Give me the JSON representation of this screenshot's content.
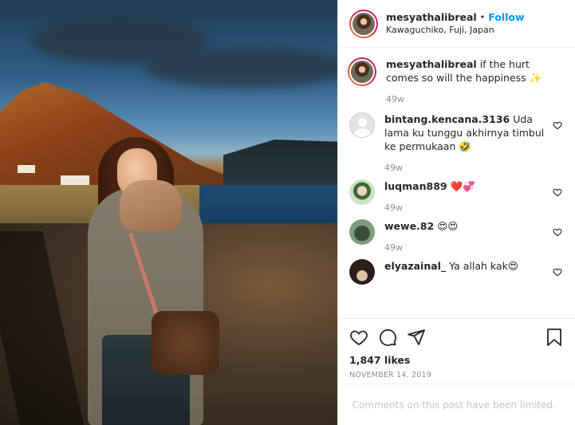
{
  "post": {
    "username": "mesyathalibreal",
    "follow_label": "Follow",
    "location": "Kawaguchiko, Fuji, Japan"
  },
  "comments": [
    {
      "username": "mesyathalibreal",
      "text": "if the hurt comes so will the happiness ✨",
      "age": "49w"
    },
    {
      "username": "bintang.kencana.3136",
      "text": "Uda lama ku tunggu akhirnya timbul ke permukaan 🤣",
      "age": "49w"
    },
    {
      "username": "luqman889",
      "text": "❤️💞",
      "age": "49w"
    },
    {
      "username": "wewe.82",
      "text": "😍😍",
      "age": "49w"
    },
    {
      "username": "elyazainal_",
      "text": "Ya allah kak😍",
      "age": ""
    }
  ],
  "actions": {
    "likes": "1,847 likes",
    "date": "NOVEMBER 14, 2019"
  },
  "footer": {
    "limited_text": "Comments on this post have been limited."
  },
  "icons": {
    "like": "heart-icon",
    "comment": "comment-icon",
    "share": "share-icon",
    "save": "bookmark-icon"
  }
}
